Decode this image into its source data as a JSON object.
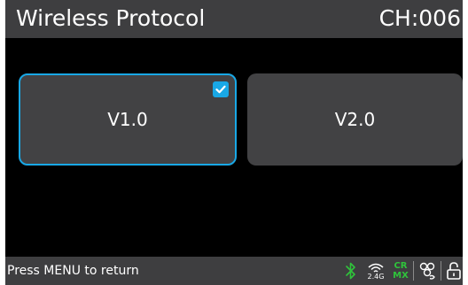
{
  "header": {
    "title": "Wireless Protocol",
    "channel": "CH:006"
  },
  "options": [
    {
      "label": "V1.0",
      "selected": true
    },
    {
      "label": "V2.0",
      "selected": false
    }
  ],
  "footer": {
    "hint": "Press MENU to return",
    "icons": {
      "bluetooth": "bluetooth-icon",
      "wireless_24g": "2.4G",
      "crmx_top": "CR",
      "crmx_bottom": "MX",
      "dmx_sources": "network-nodes-icon",
      "lock": "unlock-icon"
    }
  },
  "colors": {
    "accent": "#19a8e6",
    "bar": "#3e3e40",
    "tile": "#424244",
    "status_green": "#2fc43b"
  }
}
